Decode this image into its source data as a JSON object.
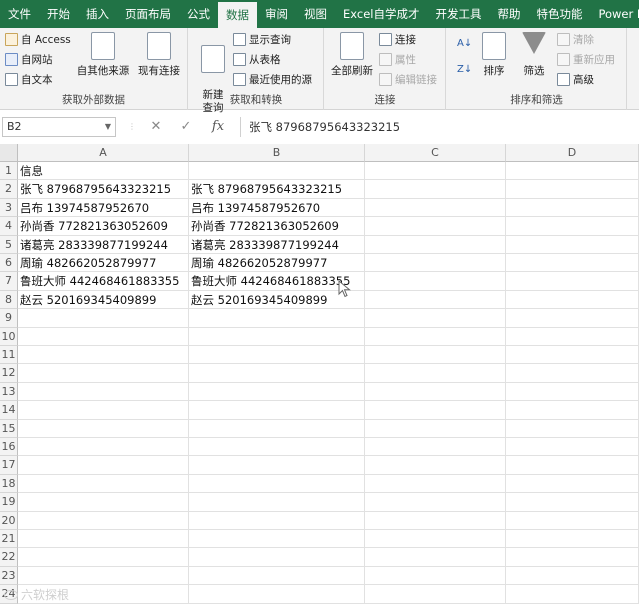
{
  "ribbon_tabs": [
    {
      "label": "文件"
    },
    {
      "label": "开始"
    },
    {
      "label": "插入"
    },
    {
      "label": "页面布局"
    },
    {
      "label": "公式"
    },
    {
      "label": "数据"
    },
    {
      "label": "审阅"
    },
    {
      "label": "视图"
    },
    {
      "label": "Excel自学成才"
    },
    {
      "label": "开发工具"
    },
    {
      "label": "帮助"
    },
    {
      "label": "特色功能"
    },
    {
      "label": "Power Pi"
    }
  ],
  "active_tab": "数据",
  "groups": {
    "external": {
      "label": "获取外部数据",
      "access": "自 Access",
      "web": "自网站",
      "text": "自文本",
      "other": "自其他来源",
      "existing": "现有连接"
    },
    "transform": {
      "label": "获取和转换",
      "new_query": "新建\n查询",
      "show_queries": "显示查询",
      "from_table": "从表格",
      "recent_sources": "最近使用的源"
    },
    "connections": {
      "label": "连接",
      "refresh_all": "全部刷新",
      "connections": "连接",
      "properties": "属性",
      "edit_links": "编辑链接"
    },
    "sort_filter": {
      "label": "排序和筛选",
      "sort": "排序",
      "filter": "筛选",
      "clear": "清除",
      "reapply": "重新应用",
      "advanced": "高级"
    }
  },
  "formula_bar": {
    "name_box": "B2",
    "fx": "fx",
    "content": "张飞 87968795643323215"
  },
  "columns": [
    "A",
    "B",
    "C",
    "D"
  ],
  "rows": [
    "1",
    "2",
    "3",
    "4",
    "5",
    "6",
    "7",
    "8",
    "9",
    "10",
    "11",
    "12",
    "13",
    "14",
    "15",
    "16",
    "17",
    "18",
    "19",
    "20",
    "21",
    "22",
    "23",
    "24"
  ],
  "cells": {
    "A": [
      "信息",
      "张飞 87968795643323215",
      "吕布 13974587952670",
      "孙尚香 772821363052609",
      "诸葛亮 283339877199244",
      "周瑜 482662052879977",
      "鲁班大师 442468461883355",
      "赵云 520169345409899"
    ],
    "B": [
      "",
      "张飞 87968795643323215",
      "吕布 13974587952670",
      "孙尚香 772821363052609",
      "诸葛亮 283339877199244",
      "周瑜 482662052879977",
      "鲁班大师 442468461883355",
      "赵云 520169345409899"
    ]
  },
  "watermark": "六软探根"
}
